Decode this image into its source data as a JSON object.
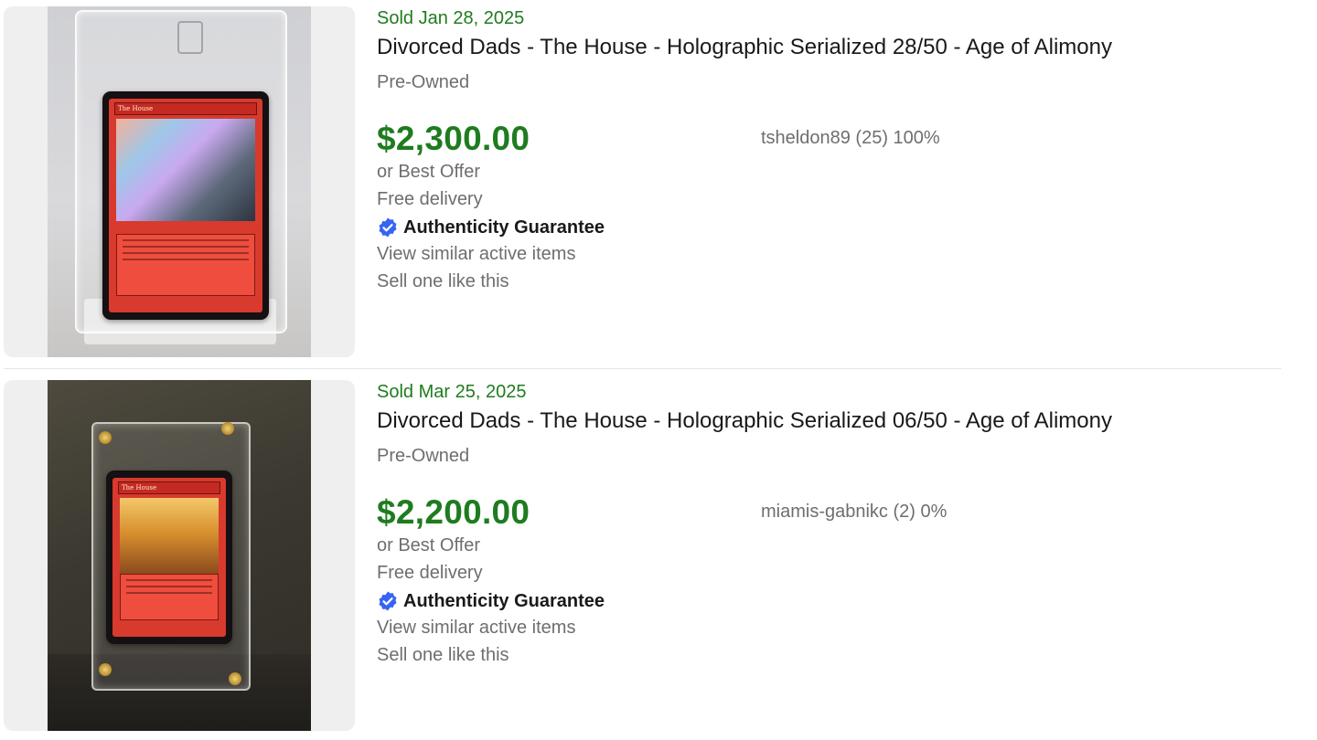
{
  "colors": {
    "price_green": "#1e7c1f",
    "sold_green": "#1e7c1f",
    "secondary_text": "#6e6e6e",
    "primary_text": "#191919",
    "verified_blue": "#3665f3"
  },
  "items": [
    {
      "sold_date": "Sold Jan 28, 2025",
      "title": "Divorced Dads - The House - Holographic Serialized 28/50 - Age of Alimony",
      "condition": "Pre-Owned",
      "price": "$2,300.00",
      "seller": "tsheldon89 (25) 100%",
      "offer": "or Best Offer",
      "shipping": "Free delivery",
      "authenticity": "Authenticity Guarantee",
      "similar_link": "View similar active items",
      "sell_link": "Sell one like this",
      "authenticity_icon": "verified-check-icon"
    },
    {
      "sold_date": "Sold Mar 25, 2025",
      "title": "Divorced Dads - The House - Holographic Serialized 06/50 - Age of Alimony",
      "condition": "Pre-Owned",
      "price": "$2,200.00",
      "seller": "miamis-gabnikc (2) 0%",
      "offer": "or Best Offer",
      "shipping": "Free delivery",
      "authenticity": "Authenticity Guarantee",
      "similar_link": "View similar active items",
      "sell_link": "Sell one like this",
      "authenticity_icon": "verified-check-icon"
    }
  ]
}
